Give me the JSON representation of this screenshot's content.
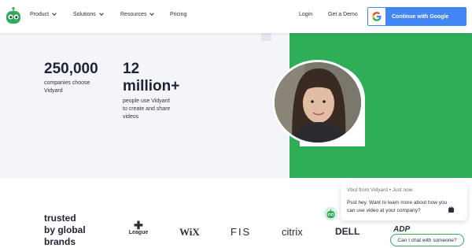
{
  "nav": {
    "logo_icon": "robot-logo-icon",
    "items": [
      {
        "label": "Product",
        "has_dropdown": true
      },
      {
        "label": "Solutions",
        "has_dropdown": true
      },
      {
        "label": "Resources",
        "has_dropdown": true
      },
      {
        "label": "Pricing",
        "has_dropdown": false
      }
    ],
    "login": "Login",
    "demo": "Get a Demo",
    "google_button": "Continue with Google"
  },
  "hero": {
    "stat1_number": "250,000",
    "stat1_line1": "companies choose",
    "stat1_line2": "Vidyard",
    "stat2_number_line1": "12",
    "stat2_number_line2": "million+",
    "stat2_line1": "people use Vidyard",
    "stat2_line2": "to create and share",
    "stat2_line3": "videos",
    "accent_color": "#2fae58"
  },
  "trusted": {
    "line1": "trusted",
    "line2": "by global",
    "line3": "brands",
    "logos": [
      "League",
      "WiX",
      "FIS",
      "citrix",
      "DELL",
      "ADP"
    ]
  },
  "chat": {
    "from": "Vbot from Vidyard • Just now",
    "message": "Psst hey. Want to learn more about how you can use video at your company?",
    "emoji_icon": "hand-wave-icon",
    "reply": "Can I chat with someone?"
  }
}
